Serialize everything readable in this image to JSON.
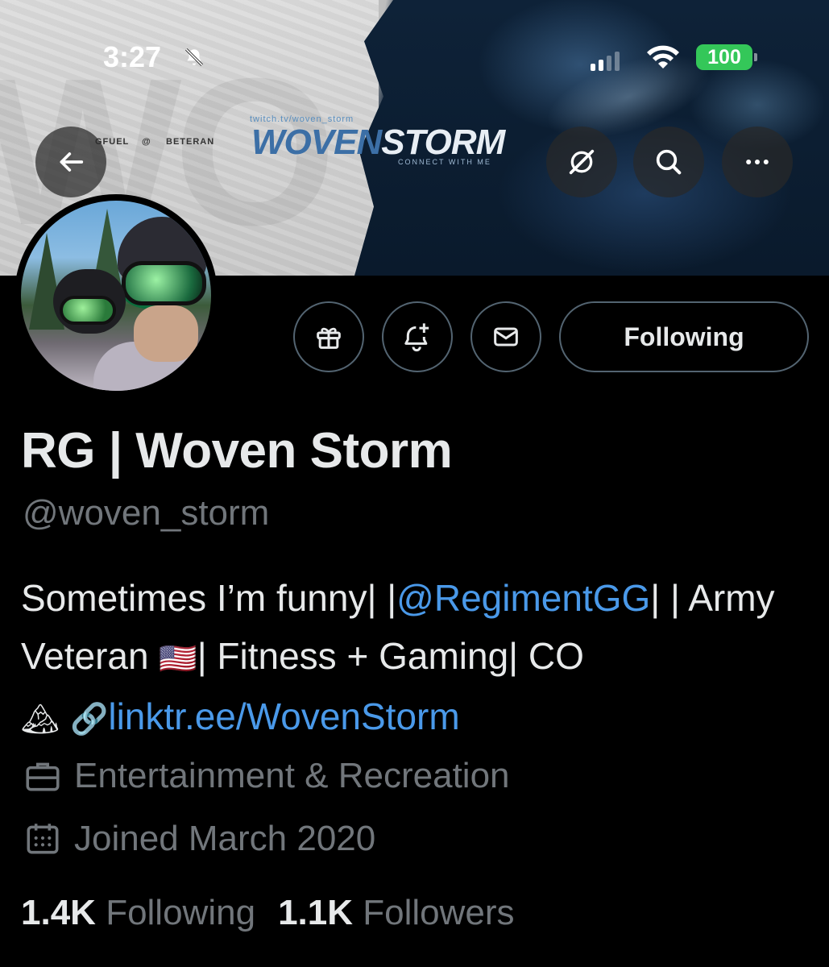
{
  "status_bar": {
    "time": "3:27",
    "battery": "100"
  },
  "banner": {
    "brand_url": "twitch.tv/woven_storm",
    "brand_word_1": "WOVEN",
    "brand_word_2": "STORM",
    "brand_tagline": "CONNECT WITH ME",
    "sponsor_1": "GFUEL",
    "sponsor_2": "BETERAN"
  },
  "header_buttons": {
    "back_icon": "arrow-left-icon",
    "grok_icon": "grok-icon",
    "search_icon": "search-icon",
    "more_icon": "more-horizontal-icon"
  },
  "actions": {
    "gift_icon": "gift-icon",
    "notify_icon": "bell-plus-icon",
    "message_icon": "envelope-icon",
    "following_label": "Following"
  },
  "profile": {
    "name": "RG | Woven Storm",
    "handle": "@woven_storm",
    "bio": {
      "part1": "Sometimes I’m funny| |",
      "mention": "@RegimentGG",
      "part2": "| | Army Veteran ",
      "flag": "🇺🇸",
      "part3": "| Fitness + Gaming| CO ",
      "mountain": "🏔",
      "link_emoji": "🔗",
      "link": "linktr.ee/WovenStorm"
    },
    "category": "Entertainment & Recreation",
    "joined": "Joined March 2020",
    "following_count": "1.4K",
    "following_label": "Following",
    "followers_count": "1.1K",
    "followers_label": "Followers"
  },
  "colors": {
    "background": "#000000",
    "text": "#e7e9ea",
    "secondary": "#71767b",
    "link": "#4a99e9",
    "battery": "#34c759"
  }
}
